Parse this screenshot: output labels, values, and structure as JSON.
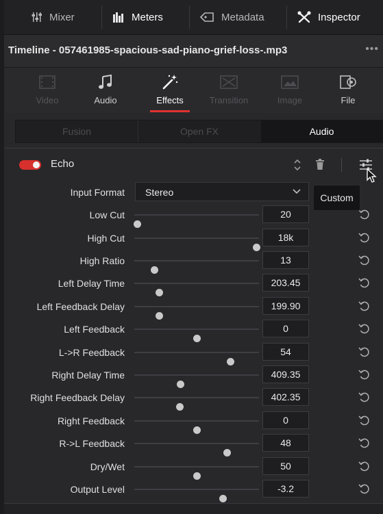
{
  "topbar": {
    "mixer": "Mixer",
    "meters": "Meters",
    "metadata": "Metadata",
    "inspector": "Inspector"
  },
  "title": "Timeline - 057461985-spacious-sad-piano-grief-loss-.mp3",
  "more": "•••",
  "categories": [
    {
      "label": "Video",
      "icon": "video-icon",
      "state": "disabled"
    },
    {
      "label": "Audio",
      "icon": "music-note-icon",
      "state": "normal"
    },
    {
      "label": "Effects",
      "icon": "magic-wand-icon",
      "state": "active"
    },
    {
      "label": "Transition",
      "icon": "transition-icon",
      "state": "disabled"
    },
    {
      "label": "Image",
      "icon": "image-icon",
      "state": "disabled"
    },
    {
      "label": "File",
      "icon": "file-icon",
      "state": "normal"
    }
  ],
  "subtabs": {
    "fusion": "Fusion",
    "openfx": "Open FX",
    "audio": "Audio"
  },
  "effect": {
    "name": "Echo",
    "enabled": true
  },
  "input_format": {
    "label": "Input Format",
    "value": "Stereo"
  },
  "tooltip": "Custom",
  "params": [
    {
      "label": "Low Cut",
      "value": "20",
      "level": 0.02
    },
    {
      "label": "High Cut",
      "value": "18k",
      "level": 0.98
    },
    {
      "label": "High Ratio",
      "value": "13",
      "level": 0.16
    },
    {
      "label": "Left Delay Time",
      "value": "203.45",
      "level": 0.2
    },
    {
      "label": "Left Feedback Delay",
      "value": "199.90",
      "level": 0.2
    },
    {
      "label": "Left Feedback",
      "value": "0",
      "level": 0.5
    },
    {
      "label": "L->R Feedback",
      "value": "54",
      "level": 0.77
    },
    {
      "label": "Right Delay Time",
      "value": "409.35",
      "level": 0.37
    },
    {
      "label": "Right Feedback Delay",
      "value": "402.35",
      "level": 0.36
    },
    {
      "label": "Right Feedback",
      "value": "0",
      "level": 0.5
    },
    {
      "label": "R->L Feedback",
      "value": "48",
      "level": 0.74
    },
    {
      "label": "Dry/Wet",
      "value": "50",
      "level": 0.5
    },
    {
      "label": "Output Level",
      "value": "-3.2",
      "level": 0.71
    }
  ],
  "colors": {
    "accent": "#e0322f",
    "panel": "#28282b"
  }
}
